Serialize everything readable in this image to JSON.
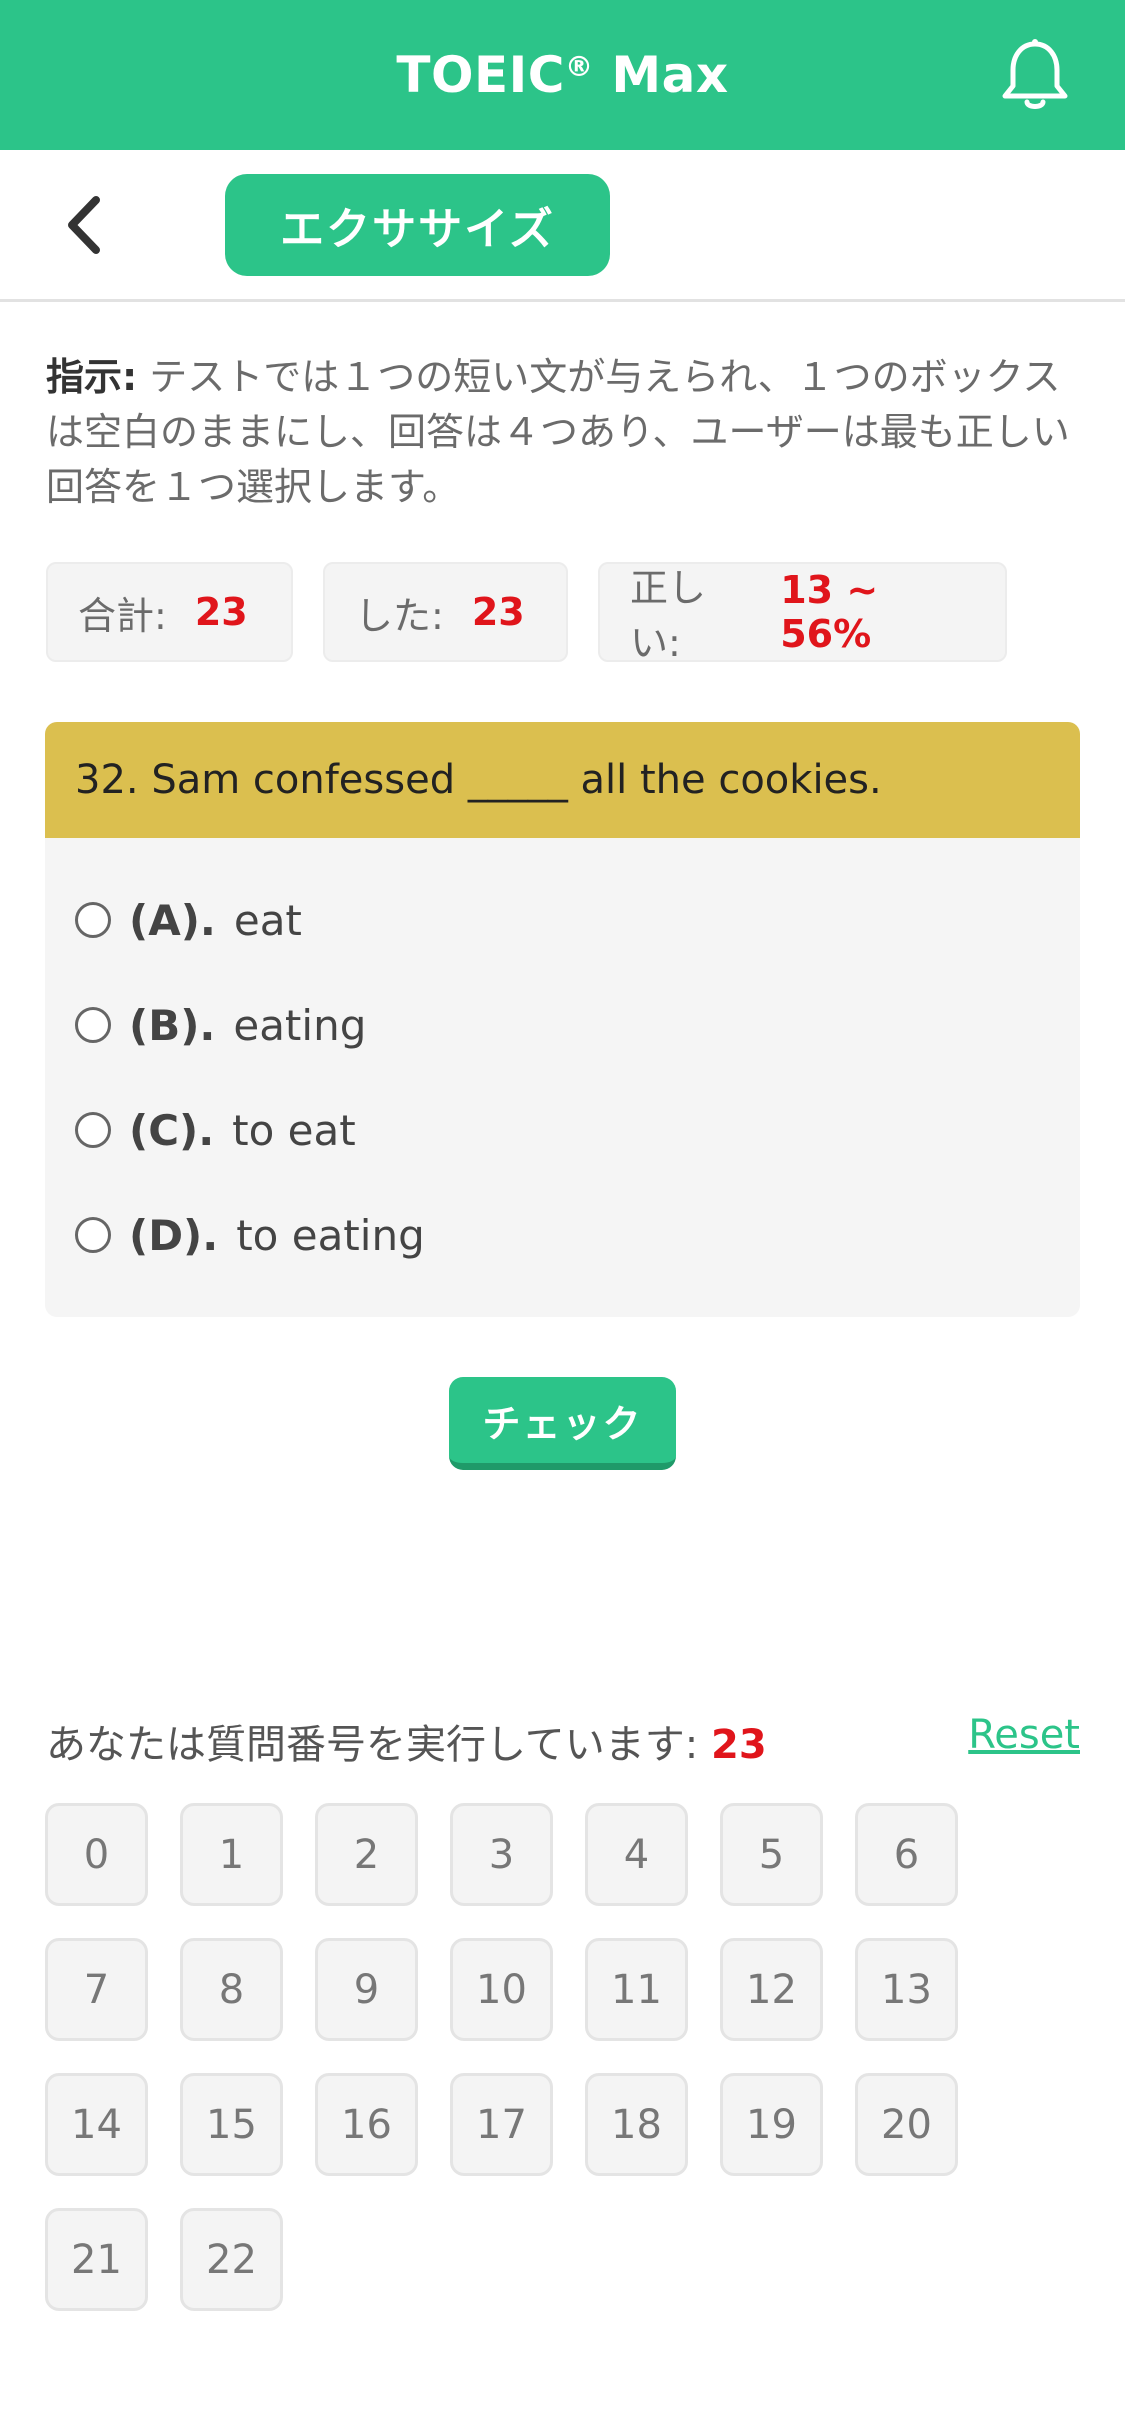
{
  "header": {
    "title": "TOEIC",
    "title_sup": "®",
    "title_suffix": " Max",
    "bell_icon": "bell-icon"
  },
  "toolbar": {
    "back_icon": "chevron-left-icon",
    "tab_label": "エクササイズ"
  },
  "instruction": {
    "label": "指示:",
    "text": " テストでは１つの短い文が与えられ、１つのボックスは空白のままにし、回答は４つあり、ユーザーは最も正しい回答を１つ選択します。"
  },
  "stats": {
    "total_label": "合計:",
    "total_value": "23",
    "done_label": "した:",
    "done_value": "23",
    "correct_label": "正しい:",
    "correct_value": "13 ~ 56%"
  },
  "question": {
    "text": "32. Sam confessed _____ all the cookies.",
    "options": [
      {
        "letter": "(A).",
        "text": "eat"
      },
      {
        "letter": "(B).",
        "text": "eating"
      },
      {
        "letter": "(C).",
        "text": "to eat"
      },
      {
        "letter": "(D).",
        "text": "to eating"
      }
    ]
  },
  "check_label": "チェック",
  "progress": {
    "label": "あなたは質問番号を実行しています:",
    "value": "23",
    "reset_label": "Reset"
  },
  "question_numbers": [
    "0",
    "1",
    "2",
    "3",
    "4",
    "5",
    "6",
    "7",
    "8",
    "9",
    "10",
    "11",
    "12",
    "13",
    "14",
    "15",
    "16",
    "17",
    "18",
    "19",
    "20",
    "21",
    "22"
  ],
  "colors": {
    "primary": "#2cc489",
    "question_bar": "#dbbf4f",
    "accent_red": "#e0151b"
  }
}
